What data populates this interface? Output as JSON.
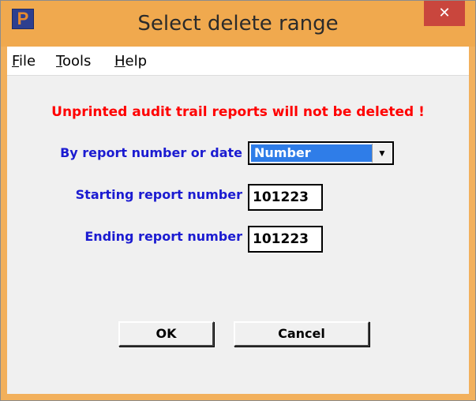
{
  "window": {
    "title": "Select delete range",
    "app_icon_letter": "P",
    "close_glyph": "✕"
  },
  "menu": {
    "items": [
      {
        "label_first": "F",
        "label_rest": "ile"
      },
      {
        "label_first": "T",
        "label_rest": "ools"
      },
      {
        "label_first": "H",
        "label_rest": "elp"
      }
    ]
  },
  "form": {
    "warning": "Unprinted audit trail reports will not be deleted !",
    "by_label": "By report number or date",
    "by_value": "Number",
    "start_label": "Starting report number",
    "start_value": "101223",
    "end_label": "Ending report number",
    "end_value": "101223"
  },
  "buttons": {
    "ok": "OK",
    "cancel": "Cancel"
  },
  "colors": {
    "titlebar": "#f0a94e",
    "close": "#c9463d",
    "warning": "#ff0000",
    "label": "#1b1bd1",
    "select_highlight": "#2f7de8"
  }
}
